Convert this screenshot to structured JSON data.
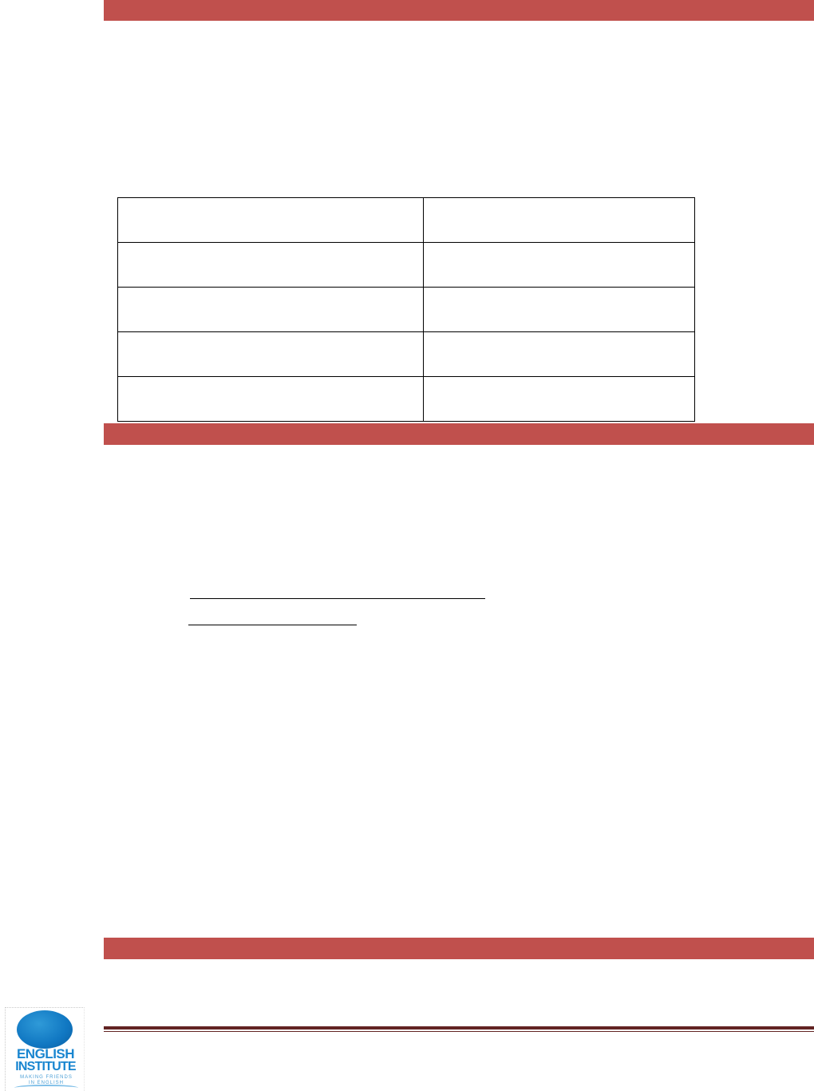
{
  "colors": {
    "section_band": "#c0504d",
    "footer_rule": "#622423",
    "logo_blue": "#1a86d0"
  },
  "table": {
    "rows": [
      [
        "",
        ""
      ],
      [
        "",
        ""
      ],
      [
        "",
        ""
      ],
      [
        "",
        ""
      ],
      [
        "",
        ""
      ]
    ]
  },
  "logo": {
    "line1": "ENGLISH",
    "line2": "INSTITUTE",
    "tagline_1": "MAKING FRIENDS",
    "tagline_2": "IN ENGLISH"
  }
}
